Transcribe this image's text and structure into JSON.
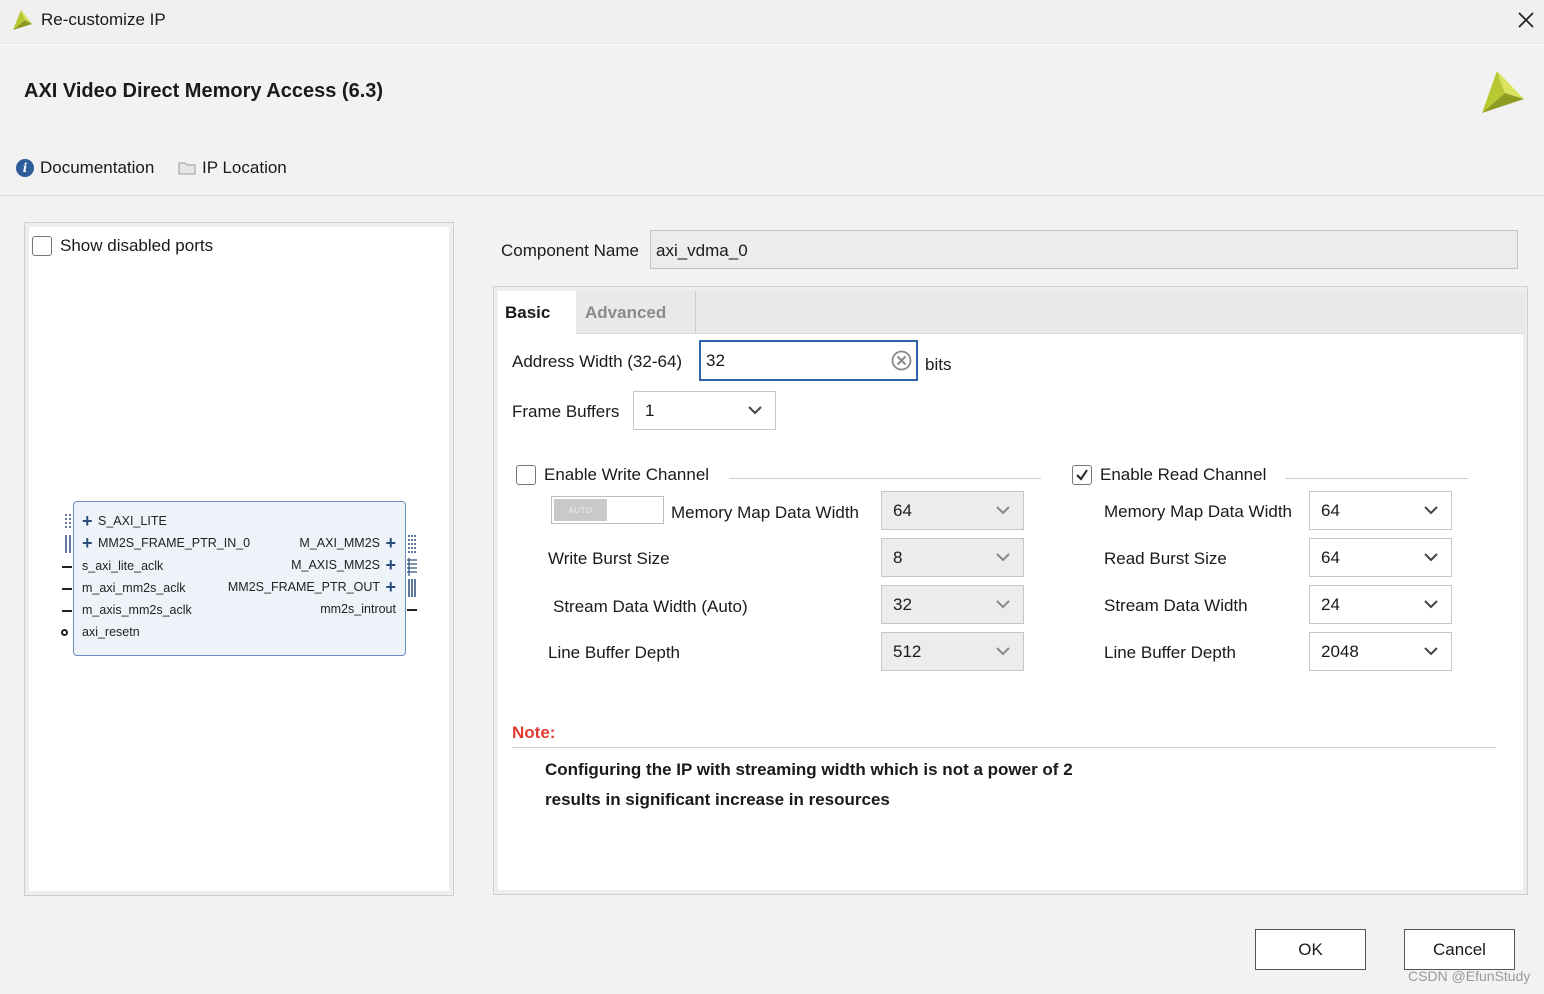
{
  "window": {
    "title": "Re-customize IP"
  },
  "header": {
    "ip_title": "AXI Video Direct Memory Access (6.3)",
    "documentation_label": "Documentation",
    "ip_location_label": "IP Location"
  },
  "symbol_panel": {
    "show_disabled_ports_label": "Show disabled ports",
    "show_disabled_ports_checked": false,
    "ports_left": [
      "S_AXI_LITE",
      "MM2S_FRAME_PTR_IN_0",
      "s_axi_lite_aclk",
      "m_axi_mm2s_aclk",
      "m_axis_mm2s_aclk",
      "axi_resetn"
    ],
    "ports_right": [
      "M_AXI_MM2S",
      "M_AXIS_MM2S",
      "MM2S_FRAME_PTR_OUT",
      "mm2s_introut"
    ]
  },
  "component": {
    "label": "Component Name",
    "value": "axi_vdma_0"
  },
  "tabs": {
    "basic": "Basic",
    "advanced": "Advanced",
    "active": "basic"
  },
  "basic": {
    "address_width_label": "Address Width (32-64)",
    "address_width_value": "32",
    "address_width_unit": "bits",
    "frame_buffers_label": "Frame Buffers",
    "frame_buffers_value": "1"
  },
  "write_channel": {
    "label": "Enable Write Channel",
    "enabled": false,
    "auto_toggle_text": "AUTO",
    "mm_data_width_label": "Memory Map Data Width",
    "mm_data_width_value": "64",
    "burst_size_label": "Write Burst Size",
    "burst_size_value": "8",
    "stream_width_label": "Stream Data Width (Auto)",
    "stream_width_value": "32",
    "line_buffer_label": "Line Buffer Depth",
    "line_buffer_value": "512"
  },
  "read_channel": {
    "label": "Enable Read Channel",
    "enabled": true,
    "mm_data_width_label": "Memory Map Data Width",
    "mm_data_width_value": "64",
    "burst_size_label": "Read Burst Size",
    "burst_size_value": "64",
    "stream_width_label": "Stream Data Width",
    "stream_width_value": "24",
    "line_buffer_label": "Line Buffer Depth",
    "line_buffer_value": "2048"
  },
  "note": {
    "label": "Note:",
    "line1": "Configuring the IP with streaming width which is not a power of 2",
    "line2": "results in significant increase in resources"
  },
  "buttons": {
    "ok": "OK",
    "cancel": "Cancel"
  },
  "watermark": "CSDN @EfunStudy",
  "colors": {
    "accent": "#2f63b0",
    "note": "#e03c31",
    "logo_green": "#b8c832"
  }
}
